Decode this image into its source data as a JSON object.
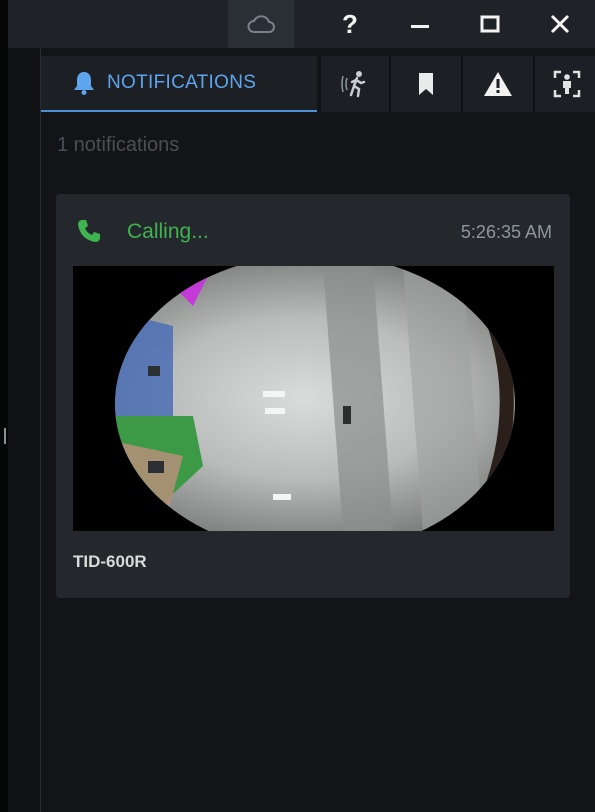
{
  "titlebar": {
    "icons": [
      "cloud-icon",
      "help-icon",
      "minimize-icon",
      "maximize-icon",
      "close-icon"
    ],
    "help_label": "?"
  },
  "tabs": {
    "notifications_label": "NOTIFICATIONS",
    "icons": [
      "bell-icon",
      "motion-icon",
      "bookmark-icon",
      "warning-icon",
      "person-detection-icon"
    ]
  },
  "notifications": {
    "count_label": "1 notifications",
    "items": [
      {
        "status": "Calling...",
        "time": "5:26:35 AM",
        "device": "TID-600R",
        "icon": "phone-icon"
      }
    ]
  },
  "colors": {
    "accent": "#5ea5ee",
    "calling": "#3fb34f",
    "background": "#121417",
    "card": "#24282d"
  }
}
